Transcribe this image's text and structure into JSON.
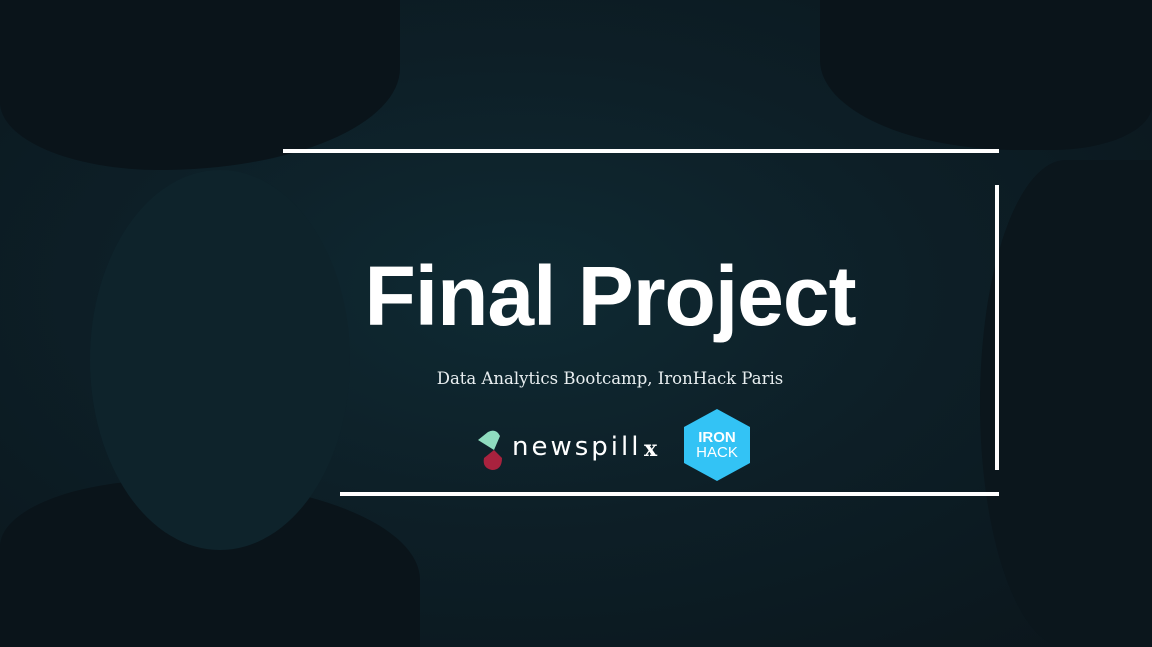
{
  "slide": {
    "title": "Final Project",
    "subtitle": "Data Analytics Bootcamp, IronHack Paris",
    "partner_logo": {
      "name": "newspill",
      "label": "newspill",
      "colors": [
        "#8fdcbf",
        "#a8223e"
      ]
    },
    "separator": "x",
    "school_logo": {
      "line1": "IRON",
      "line2": "HACK",
      "color": "#33c3f5"
    }
  },
  "colors": {
    "background": "#0d1f27",
    "frame": "#ffffff"
  }
}
